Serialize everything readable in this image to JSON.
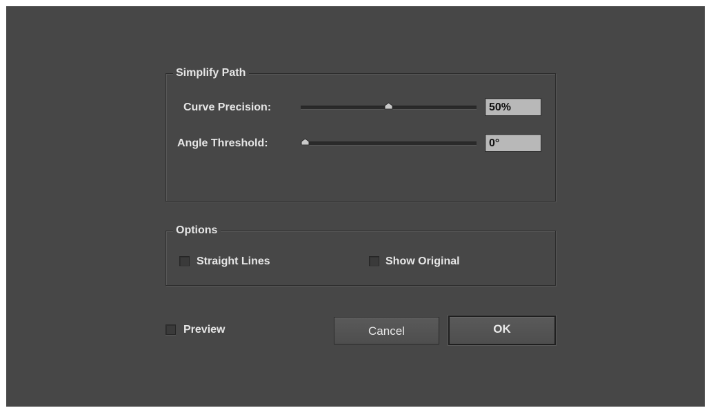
{
  "simplify_path": {
    "title": "Simplify Path",
    "curve_precision": {
      "label": "Curve Precision:",
      "value": "50%",
      "slider_fraction": 0.5
    },
    "angle_threshold": {
      "label": "Angle Threshold:",
      "value": "0°",
      "slider_fraction": 0.0
    }
  },
  "options": {
    "title": "Options",
    "straight_lines": {
      "label": "Straight Lines",
      "checked": false
    },
    "show_original": {
      "label": "Show Original",
      "checked": false
    }
  },
  "footer": {
    "preview": {
      "label": "Preview",
      "checked": false
    },
    "cancel_label": "Cancel",
    "ok_label": "OK"
  },
  "colors": {
    "dialog_bg": "#474747",
    "text": "#e6e6e6",
    "field_bg": "#b8b8b8"
  },
  "icons": [
    "slider-thumb-icon",
    "checkbox-icon"
  ]
}
